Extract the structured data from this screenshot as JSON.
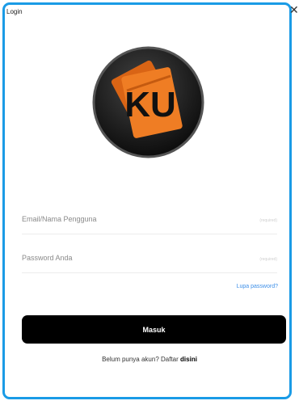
{
  "window": {
    "title": "Login",
    "close_glyph": "✕"
  },
  "logo": {
    "text": "KU",
    "icon": "ku-card-logo"
  },
  "form": {
    "email": {
      "placeholder": "Email/Nama Pengguna",
      "hint": "(required)"
    },
    "password": {
      "placeholder": "Password Anda",
      "hint": "(required)"
    },
    "forgot_label": "Lupa password?",
    "submit_label": "Masuk"
  },
  "register": {
    "prompt": "Belum punya akun? Daftar",
    "link": "disini"
  },
  "colors": {
    "frame": "#1a9be6",
    "logo_orange": "#e8731f",
    "button": "#000000",
    "link": "#3d8fe8"
  }
}
